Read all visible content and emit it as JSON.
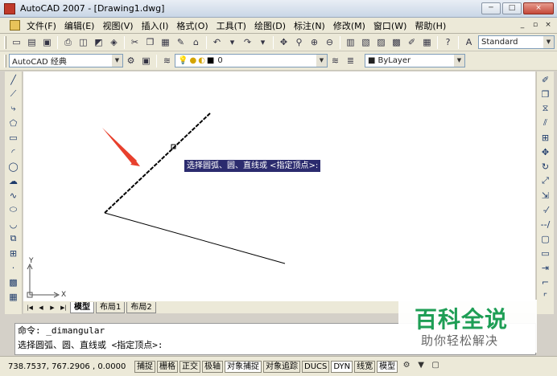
{
  "window": {
    "title": "AutoCAD 2007 - [Drawing1.dwg]",
    "controls": [
      "─",
      "□",
      "×"
    ]
  },
  "menu": {
    "items": [
      "文件(F)",
      "编辑(E)",
      "视图(V)",
      "插入(I)",
      "格式(O)",
      "工具(T)",
      "绘图(D)",
      "标注(N)",
      "修改(M)",
      "窗口(W)",
      "帮助(H)"
    ],
    "doc_controls": [
      "_",
      "▫",
      "×"
    ]
  },
  "toolbar": {
    "text_style": "Standard",
    "workspace": "AutoCAD 经典",
    "layer": "0",
    "color": "ByLayer"
  },
  "drawing": {
    "tooltip": "选择圆弧、圆、直线或 <指定顶点>:",
    "ucs_x": "X",
    "ucs_y": "Y"
  },
  "tabs": {
    "items": [
      "模型",
      "布局1",
      "布局2"
    ],
    "active": "模型"
  },
  "command": {
    "line1": "命令: _dimangular",
    "line2": "选择圆弧、圆、直线或 <指定顶点>:"
  },
  "status": {
    "coords": "738.7537,   767.2906 , 0.0000",
    "buttons": [
      {
        "label": "捕捉",
        "on": false
      },
      {
        "label": "栅格",
        "on": false
      },
      {
        "label": "正交",
        "on": false
      },
      {
        "label": "极轴",
        "on": false
      },
      {
        "label": "对象捕捉",
        "on": true
      },
      {
        "label": "对象追踪",
        "on": false
      },
      {
        "label": "DUCS",
        "on": false
      },
      {
        "label": "DYN",
        "on": true
      },
      {
        "label": "线宽",
        "on": false
      },
      {
        "label": "模型",
        "on": true
      }
    ]
  },
  "watermark": {
    "title": "百科全说",
    "subtitle": "助你轻松解决"
  },
  "colors": {
    "tooltip_bg": "#2b2b6e",
    "arrow": "#e8402d",
    "watermark_green": "#1e9e55"
  }
}
